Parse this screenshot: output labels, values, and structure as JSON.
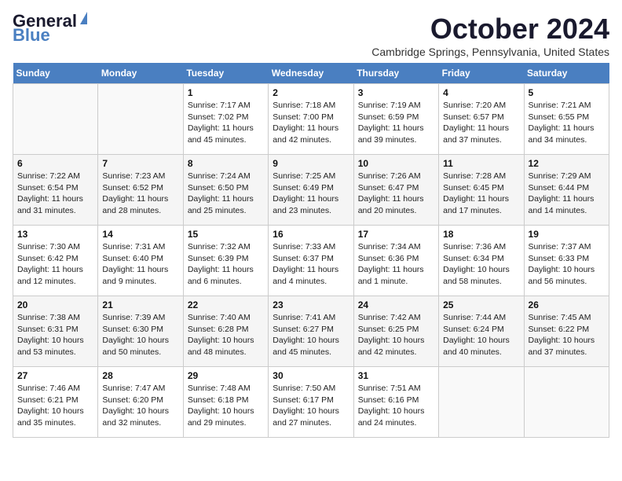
{
  "header": {
    "logo_general": "General",
    "logo_blue": "Blue",
    "month_title": "October 2024",
    "location": "Cambridge Springs, Pennsylvania, United States"
  },
  "weekdays": [
    "Sunday",
    "Monday",
    "Tuesday",
    "Wednesday",
    "Thursday",
    "Friday",
    "Saturday"
  ],
  "weeks": [
    [
      {
        "day": "",
        "info": ""
      },
      {
        "day": "",
        "info": ""
      },
      {
        "day": "1",
        "info": "Sunrise: 7:17 AM\nSunset: 7:02 PM\nDaylight: 11 hours and 45 minutes."
      },
      {
        "day": "2",
        "info": "Sunrise: 7:18 AM\nSunset: 7:00 PM\nDaylight: 11 hours and 42 minutes."
      },
      {
        "day": "3",
        "info": "Sunrise: 7:19 AM\nSunset: 6:59 PM\nDaylight: 11 hours and 39 minutes."
      },
      {
        "day": "4",
        "info": "Sunrise: 7:20 AM\nSunset: 6:57 PM\nDaylight: 11 hours and 37 minutes."
      },
      {
        "day": "5",
        "info": "Sunrise: 7:21 AM\nSunset: 6:55 PM\nDaylight: 11 hours and 34 minutes."
      }
    ],
    [
      {
        "day": "6",
        "info": "Sunrise: 7:22 AM\nSunset: 6:54 PM\nDaylight: 11 hours and 31 minutes."
      },
      {
        "day": "7",
        "info": "Sunrise: 7:23 AM\nSunset: 6:52 PM\nDaylight: 11 hours and 28 minutes."
      },
      {
        "day": "8",
        "info": "Sunrise: 7:24 AM\nSunset: 6:50 PM\nDaylight: 11 hours and 25 minutes."
      },
      {
        "day": "9",
        "info": "Sunrise: 7:25 AM\nSunset: 6:49 PM\nDaylight: 11 hours and 23 minutes."
      },
      {
        "day": "10",
        "info": "Sunrise: 7:26 AM\nSunset: 6:47 PM\nDaylight: 11 hours and 20 minutes."
      },
      {
        "day": "11",
        "info": "Sunrise: 7:28 AM\nSunset: 6:45 PM\nDaylight: 11 hours and 17 minutes."
      },
      {
        "day": "12",
        "info": "Sunrise: 7:29 AM\nSunset: 6:44 PM\nDaylight: 11 hours and 14 minutes."
      }
    ],
    [
      {
        "day": "13",
        "info": "Sunrise: 7:30 AM\nSunset: 6:42 PM\nDaylight: 11 hours and 12 minutes."
      },
      {
        "day": "14",
        "info": "Sunrise: 7:31 AM\nSunset: 6:40 PM\nDaylight: 11 hours and 9 minutes."
      },
      {
        "day": "15",
        "info": "Sunrise: 7:32 AM\nSunset: 6:39 PM\nDaylight: 11 hours and 6 minutes."
      },
      {
        "day": "16",
        "info": "Sunrise: 7:33 AM\nSunset: 6:37 PM\nDaylight: 11 hours and 4 minutes."
      },
      {
        "day": "17",
        "info": "Sunrise: 7:34 AM\nSunset: 6:36 PM\nDaylight: 11 hours and 1 minute."
      },
      {
        "day": "18",
        "info": "Sunrise: 7:36 AM\nSunset: 6:34 PM\nDaylight: 10 hours and 58 minutes."
      },
      {
        "day": "19",
        "info": "Sunrise: 7:37 AM\nSunset: 6:33 PM\nDaylight: 10 hours and 56 minutes."
      }
    ],
    [
      {
        "day": "20",
        "info": "Sunrise: 7:38 AM\nSunset: 6:31 PM\nDaylight: 10 hours and 53 minutes."
      },
      {
        "day": "21",
        "info": "Sunrise: 7:39 AM\nSunset: 6:30 PM\nDaylight: 10 hours and 50 minutes."
      },
      {
        "day": "22",
        "info": "Sunrise: 7:40 AM\nSunset: 6:28 PM\nDaylight: 10 hours and 48 minutes."
      },
      {
        "day": "23",
        "info": "Sunrise: 7:41 AM\nSunset: 6:27 PM\nDaylight: 10 hours and 45 minutes."
      },
      {
        "day": "24",
        "info": "Sunrise: 7:42 AM\nSunset: 6:25 PM\nDaylight: 10 hours and 42 minutes."
      },
      {
        "day": "25",
        "info": "Sunrise: 7:44 AM\nSunset: 6:24 PM\nDaylight: 10 hours and 40 minutes."
      },
      {
        "day": "26",
        "info": "Sunrise: 7:45 AM\nSunset: 6:22 PM\nDaylight: 10 hours and 37 minutes."
      }
    ],
    [
      {
        "day": "27",
        "info": "Sunrise: 7:46 AM\nSunset: 6:21 PM\nDaylight: 10 hours and 35 minutes."
      },
      {
        "day": "28",
        "info": "Sunrise: 7:47 AM\nSunset: 6:20 PM\nDaylight: 10 hours and 32 minutes."
      },
      {
        "day": "29",
        "info": "Sunrise: 7:48 AM\nSunset: 6:18 PM\nDaylight: 10 hours and 29 minutes."
      },
      {
        "day": "30",
        "info": "Sunrise: 7:50 AM\nSunset: 6:17 PM\nDaylight: 10 hours and 27 minutes."
      },
      {
        "day": "31",
        "info": "Sunrise: 7:51 AM\nSunset: 6:16 PM\nDaylight: 10 hours and 24 minutes."
      },
      {
        "day": "",
        "info": ""
      },
      {
        "day": "",
        "info": ""
      }
    ]
  ]
}
